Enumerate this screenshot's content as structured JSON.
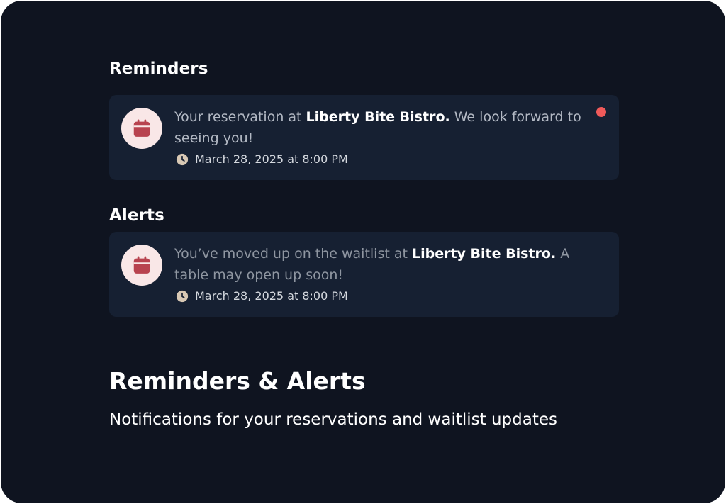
{
  "reminders": {
    "heading": "Reminders",
    "items": [
      {
        "text_before": "Your reservation at ",
        "restaurant": "Liberty Bite Bistro.",
        "text_after": " We look forward to seeing you!",
        "timestamp": "March 28, 2025 at 8:00 PM",
        "unread": true
      }
    ]
  },
  "alerts": {
    "heading": "Alerts",
    "items": [
      {
        "text_before": "You’ve moved up on the waitlist at ",
        "restaurant": "Liberty Bite Bistro.",
        "text_after": " A table may open up soon!",
        "timestamp": "March 28, 2025 at 8:00 PM",
        "unread": false
      }
    ]
  },
  "header": {
    "title": "Reminders & Alerts",
    "subtitle": "Notifications for your reservations and waitlist updates"
  },
  "colors": {
    "background": "#0f1420",
    "card": "#162032",
    "icon_circle": "#f9e7e7",
    "icon": "#b8434f",
    "clock": "#d8c8b4",
    "unread_dot": "#f05a5a"
  },
  "icons": {
    "notification": "calendar-icon",
    "time": "clock-icon"
  }
}
